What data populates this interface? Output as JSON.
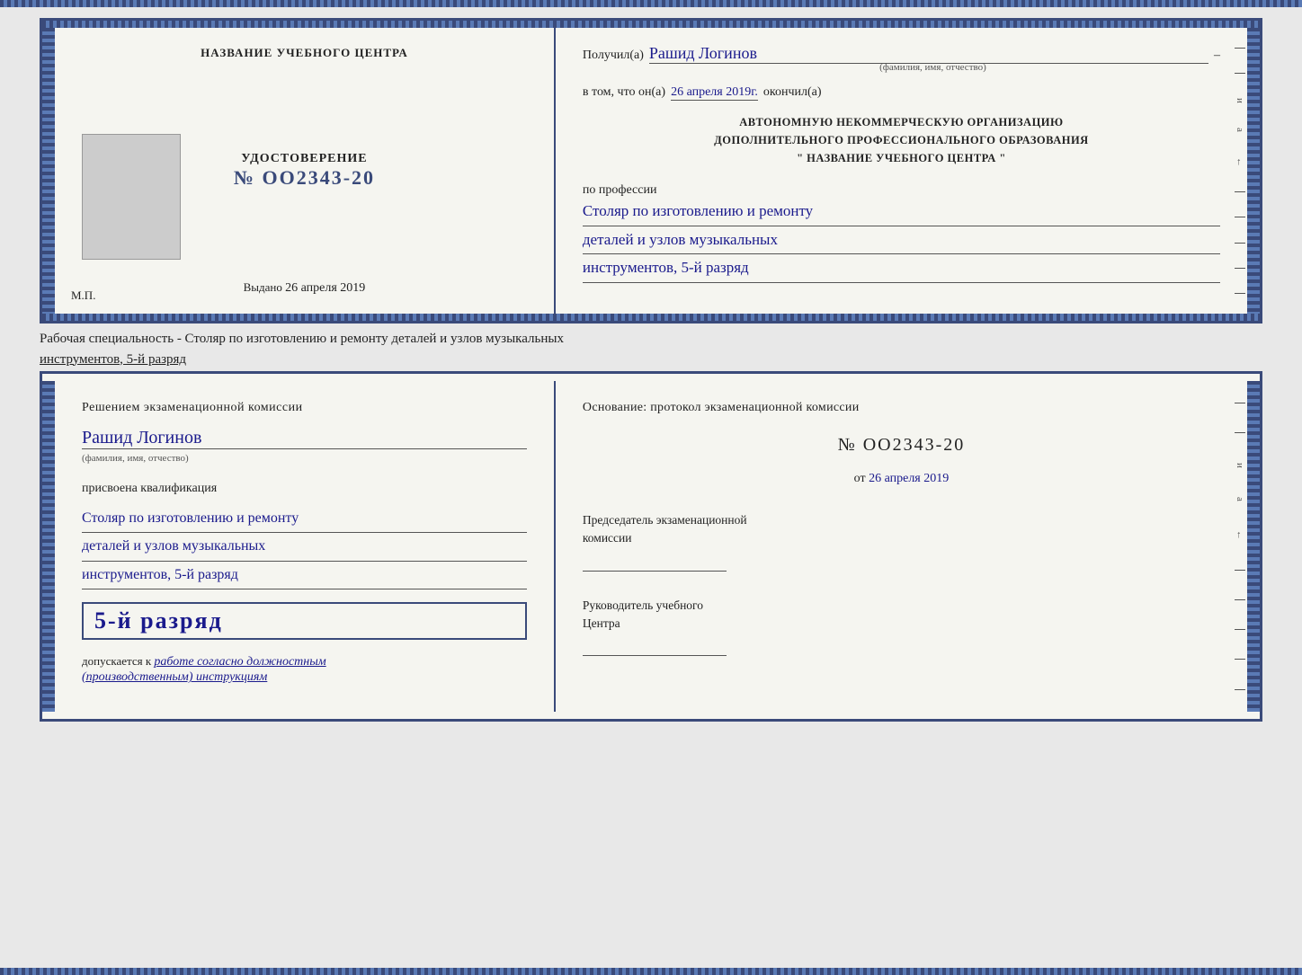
{
  "cert_top": {
    "left": {
      "title": "НАЗВАНИЕ УЧЕБНОГО ЦЕНТРА",
      "udost_label": "УДОСТОВЕРЕНИЕ",
      "udost_number": "№ OO2343-20",
      "vydano_label": "Выдано",
      "vydano_date": "26 апреля 2019",
      "mp": "М.П."
    },
    "right": {
      "recipient_prefix": "Получил(а)",
      "recipient_name": "Рашид Логинов",
      "recipient_sub": "(фамилия, имя, отчество)",
      "date_prefix": "в том, что он(а)",
      "date_value": "26 апреля 2019г.",
      "date_suffix": "окончил(а)",
      "org_line1": "АВТОНОМНУЮ НЕКОММЕРЧЕСКУЮ ОРГАНИЗАЦИЮ",
      "org_line2": "ДОПОЛНИТЕЛЬНОГО ПРОФЕССИОНАЛЬНОГО ОБРАЗОВАНИЯ",
      "org_line3": "\"  НАЗВАНИЕ УЧЕБНОГО ЦЕНТРА  \"",
      "profession_label": "по профессии",
      "profession_line1": "Столяр по изготовлению и ремонту",
      "profession_line2": "деталей и узлов музыкальных",
      "profession_line3": "инструментов, 5-й разряд"
    }
  },
  "subtitle": {
    "prefix": "Рабочая специальность - Столяр по изготовлению и ремонту деталей и узлов музыкальных",
    "underlined": "инструментов, 5-й разряд"
  },
  "cert_bottom": {
    "left": {
      "decision_title": "Решением  экзаменационной  комиссии",
      "person_name": "Рашид Логинов",
      "fio_sub": "(фамилия, имя, отчество)",
      "qualification_label": "присвоена квалификация",
      "qualification_line1": "Столяр по изготовлению и ремонту",
      "qualification_line2": "деталей и узлов музыкальных",
      "qualification_line3": "инструментов, 5-й разряд",
      "highlight_text": "5-й разряд",
      "dopusk_prefix": "допускается к",
      "dopusk_handwritten": "работе согласно должностным",
      "dopusk_handwritten2": "(производственным) инструкциям"
    },
    "right": {
      "osnov_label": "Основание: протокол экзаменационной  комиссии",
      "protokol_number": "№  OO2343-20",
      "ot_prefix": "от",
      "ot_date": "26 апреля 2019",
      "chairman_title": "Председатель экзаменационной",
      "chairman_title2": "комиссии",
      "director_title": "Руководитель учебного",
      "director_title2": "Центра"
    }
  }
}
